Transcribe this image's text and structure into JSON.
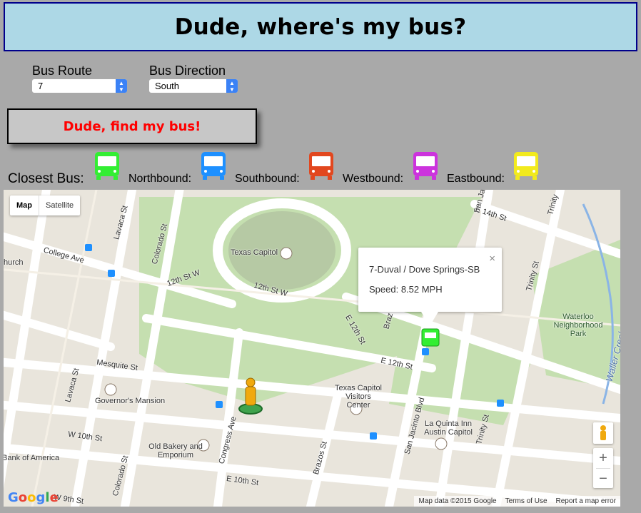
{
  "header": {
    "title": "Dude, where's my bus?"
  },
  "route": {
    "label": "Bus Route",
    "value": "7"
  },
  "direction": {
    "label": "Bus Direction",
    "value": "South"
  },
  "find_button": {
    "label": "Dude, find my bus!"
  },
  "legend": {
    "closest": {
      "label": "Closest Bus:",
      "color": "#33ee33"
    },
    "north": {
      "label": "Northbound:",
      "color": "#1e90ff"
    },
    "south": {
      "label": "Southbound:",
      "color": "#e2471e"
    },
    "west": {
      "label": "Westbound:",
      "color": "#cc33dd"
    },
    "east": {
      "label": "Eastbound:",
      "color": "#f2ea1d"
    }
  },
  "map": {
    "type_controls": {
      "map": "Map",
      "satellite": "Satellite"
    },
    "info_window": {
      "title": "7-Duval / Dove Springs-SB",
      "speed": "Speed: 8.52 MPH"
    },
    "labels": {
      "texas_capitol": "Texas Capitol",
      "college_ave": "College Ave",
      "church": "hurch",
      "lavaca_st_top": "Lavaca St",
      "colorado_st_top": "Colorado St",
      "twelfth_w_left": "12th St W",
      "twelfth_w_mid": "12th St W",
      "e12th_diag": "E 12th St",
      "brazos_top": "Braz",
      "san_jacinto_top": "San Ja",
      "e14th": "E 14th St",
      "trinity_top": "Trinity",
      "trinity_mid": "Trinity St",
      "waterloo": "Waterloo Neighborhood Park",
      "waller": "Waller Creek",
      "e12th": "E 12th St",
      "mesquite": "Mesquite St",
      "lavaca_low": "Lavaca St",
      "governors": "Governor's Mansion",
      "visitors": "Texas Capitol Visitors Center",
      "san_jacinto_blvd": "San Jacinto Blvd",
      "la_quinta": "La Quinta Inn Austin Capitol",
      "trinity_low": "Trinity St",
      "congress": "Congress Ave",
      "w10th": "W 10th St",
      "old_bakery": "Old Bakery and Emporium",
      "brazos_low": "Brazos St",
      "bank": "Bank of America",
      "colorado_low": "Colorado St",
      "e10th": "E 10th St",
      "w9th": "W 9th St"
    },
    "zoom_in": "+",
    "zoom_out": "−",
    "close": "×",
    "google": "Google",
    "footer": {
      "data": "Map data ©2015 Google",
      "terms": "Terms of Use",
      "report": "Report a map error"
    }
  }
}
